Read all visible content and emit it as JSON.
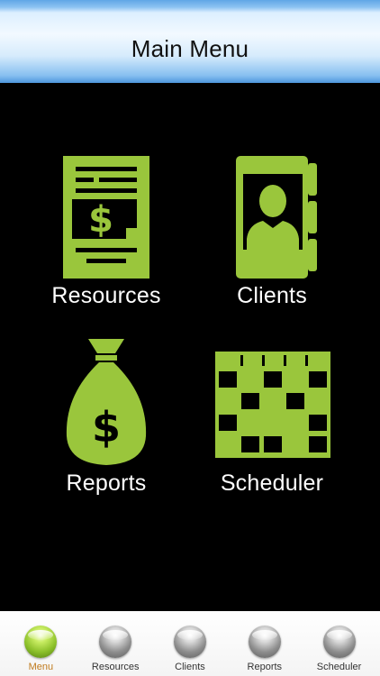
{
  "header": {
    "title": "Main Menu"
  },
  "colors": {
    "icon_green": "#9ac63c",
    "icon_dark": "#000000",
    "active_tab_label": "#c07b1e",
    "header_blue": "#5fa6e6"
  },
  "menu": {
    "resources": {
      "label": "Resources",
      "icon": "document-dollar-icon"
    },
    "clients": {
      "label": "Clients",
      "icon": "address-book-icon"
    },
    "reports": {
      "label": "Reports",
      "icon": "money-bag-icon"
    },
    "scheduler": {
      "label": "Scheduler",
      "icon": "calendar-grid-icon"
    }
  },
  "tabbar": {
    "tabs": [
      {
        "label": "Menu",
        "active": true
      },
      {
        "label": "Resources",
        "active": false
      },
      {
        "label": "Clients",
        "active": false
      },
      {
        "label": "Reports",
        "active": false
      },
      {
        "label": "Scheduler",
        "active": false
      }
    ]
  }
}
